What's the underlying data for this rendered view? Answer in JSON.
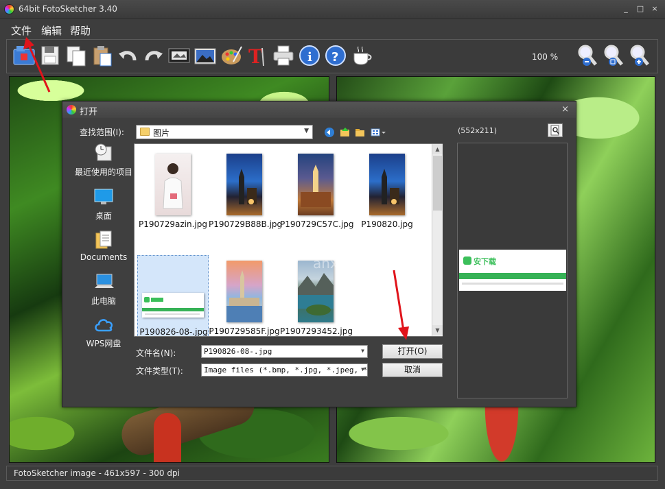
{
  "window": {
    "title": "64bit FotoSketcher 3.40",
    "controls": [
      "_",
      "□",
      "×"
    ]
  },
  "menu": [
    "文件",
    "编辑",
    "帮助"
  ],
  "toolbar": {
    "zoom": "100 %"
  },
  "statusbar": {
    "text": "FotoSketcher image - 461x597 - 300 dpi"
  },
  "dialog": {
    "title": "打开",
    "close": "×",
    "look_in_label": "查找范围(I):",
    "look_in_value": "图片",
    "places": [
      {
        "label": "最近使用的项目",
        "icon": "recent-icon"
      },
      {
        "label": "桌面",
        "icon": "desktop-icon"
      },
      {
        "label": "Documents",
        "icon": "documents-icon"
      },
      {
        "label": "此电脑",
        "icon": "computer-icon"
      },
      {
        "label": "WPS网盘",
        "icon": "cloud-icon"
      }
    ],
    "files": [
      {
        "name": "P190729azin.jpg",
        "selected": false
      },
      {
        "name": "P190729B88B.jpg",
        "selected": false
      },
      {
        "name": "P190729C57C.jpg",
        "selected": false
      },
      {
        "name": "P190820.jpg",
        "selected": false
      },
      {
        "name": "P190826-08-.jpg",
        "selected": true
      },
      {
        "name": "P190729585F.jpg",
        "selected": false
      },
      {
        "name": "P1907293452.jpg",
        "selected": false
      }
    ],
    "filename_label": "文件名(N):",
    "filename_value": "P190826-08-.jpg",
    "filetype_label": "文件类型(T):",
    "filetype_value": "Image files (*.bmp, *.jpg, *.jpeg, *.",
    "open_button": "打开(O)",
    "cancel_button": "取消",
    "preview_dims": "(552x211)",
    "preview_logo": "安下载"
  },
  "watermark": {
    "text": "安下载",
    "sub": "anxz.com"
  },
  "colors": {
    "arrow": "#e0141b",
    "selection": "#d4e6fa"
  }
}
